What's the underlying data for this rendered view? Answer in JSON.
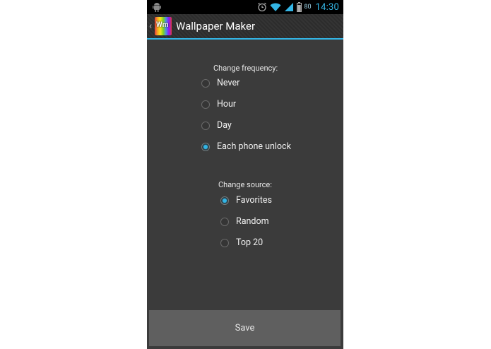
{
  "status_bar": {
    "battery": "80",
    "time": "14:30",
    "icons": [
      "android-icon",
      "alarm-icon",
      "wifi-icon",
      "signal-icon",
      "battery-icon"
    ]
  },
  "action_bar": {
    "app_icon_text": "Wm",
    "title": "Wallpaper Maker"
  },
  "frequency": {
    "label": "Change frequency:",
    "options": [
      {
        "label": "Never",
        "checked": false
      },
      {
        "label": "Hour",
        "checked": false
      },
      {
        "label": "Day",
        "checked": false
      },
      {
        "label": "Each phone unlock",
        "checked": true
      }
    ]
  },
  "source": {
    "label": "Change source:",
    "options": [
      {
        "label": "Favorites",
        "checked": true
      },
      {
        "label": "Random",
        "checked": false
      },
      {
        "label": "Top 20",
        "checked": false
      }
    ]
  },
  "save_label": "Save",
  "colors": {
    "accent": "#33b5e5",
    "background": "#3b3b3b",
    "button": "#5f5f5f"
  }
}
